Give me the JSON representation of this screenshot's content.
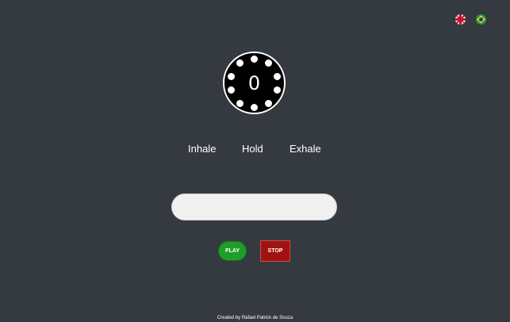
{
  "languages": [
    {
      "name": "English",
      "icon": "uk-flag-icon"
    },
    {
      "name": "Português",
      "icon": "brazil-flag-icon"
    }
  ],
  "timer": {
    "count": "0"
  },
  "phases": {
    "inhale": "Inhale",
    "hold": "Hold",
    "exhale": "Exhale"
  },
  "input": {
    "value": ""
  },
  "buttons": {
    "play": "PLAY",
    "stop": "STOP"
  },
  "colors": {
    "background": "#343a40",
    "play": "#1f9d2a",
    "stop": "#a31212"
  },
  "footer": {
    "credit": "Created by Rafael Patrick de Souza"
  }
}
